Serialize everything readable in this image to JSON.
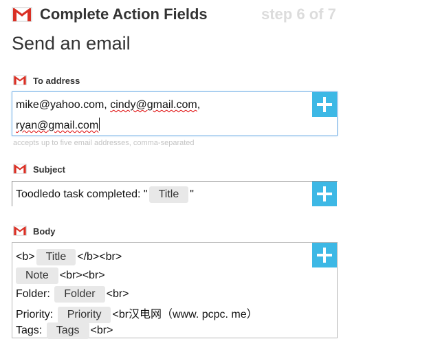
{
  "header": {
    "title": "Complete Action Fields",
    "step": "step 6 of 7"
  },
  "section": {
    "heading": "Send an email"
  },
  "fields": {
    "to": {
      "label": "To address",
      "line1_a": "mike@yahoo.com",
      "line1_sep": ", ",
      "line1_b": "cindy@gmail.com",
      "line1_end": ",",
      "line2": "ryan@gmail.com",
      "hint": "accepts up to five email addresses, comma-separated"
    },
    "subject": {
      "label": "Subject",
      "prefix": "Toodledo task completed: \"",
      "token": "Title",
      "suffix": "\""
    },
    "body": {
      "label": "Body",
      "lines": [
        {
          "pre": "<b>",
          "token": "Title",
          "post": "</b><br>"
        },
        {
          "pre": "",
          "token": "Note",
          "post": "<br><br>"
        },
        {
          "pre": "Folder:",
          "token": "Folder",
          "post": "<br>"
        },
        {
          "pre": "Priority:",
          "token": "Priority",
          "post": "<br"
        },
        {
          "pre": "Tags:",
          "token": "Tags",
          "post": "<br>"
        }
      ],
      "watermark": "汉电网（www. pcpc. me）"
    }
  },
  "icons": {
    "gmail": "gmail-icon",
    "plus": "plus-icon"
  },
  "colors": {
    "accent": "#3db8e5",
    "gmail_red": "#d93025",
    "step_text": "#dcdcdc",
    "focus_border": "#7fb6e8"
  }
}
